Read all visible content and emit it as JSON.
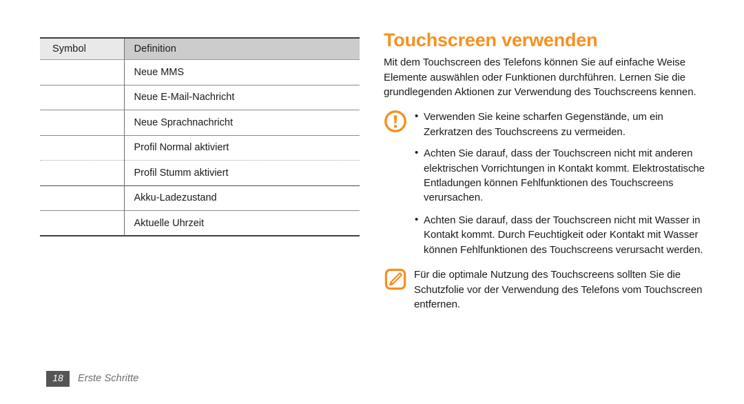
{
  "table": {
    "headers": [
      "Symbol",
      "Definition"
    ],
    "rows": [
      {
        "symbol_icon": "mms-message-icon",
        "definition": "Neue MMS"
      },
      {
        "symbol_icon": "email-message-icon",
        "definition": "Neue E-Mail-Nachricht"
      },
      {
        "symbol_icon": "voice-message-icon",
        "definition": "Neue Sprachnachricht"
      },
      {
        "symbol_icon": "profile-normal-icon",
        "definition": "Profil Normal aktiviert"
      },
      {
        "symbol_icon": "profile-silent-icon",
        "definition": "Profil Stumm aktiviert"
      },
      {
        "symbol_icon": "battery-level-icon",
        "definition": "Akku-Ladezustand"
      },
      {
        "symbol_icon": "clock-icon",
        "definition": "Aktuelle Uhrzeit"
      }
    ]
  },
  "article": {
    "title": "Touchscreen verwenden",
    "intro": "Mit dem Touchscreen des Telefons können Sie auf einfache Weise Elemente auswählen oder Funktionen durchführen. Lernen Sie die grundlegenden Aktionen zur Verwendung des Touchscreens kennen.",
    "warning": {
      "icon": "warning-exclamation-icon",
      "bullets": [
        "Verwenden Sie keine scharfen Gegenstände, um ein Zerkratzen des Touchscreens zu vermeiden.",
        "Achten Sie darauf, dass der Touchscreen nicht mit anderen elektrischen Vorrichtungen in Kontakt kommt. Elektrostatische Entladungen können Fehlfunktionen des Touchscreens verursachen."
      ],
      "bullets_continued": [
        "Achten Sie darauf, dass der Touchscreen nicht mit Wasser in Kontakt kommt. Durch Feuchtigkeit oder Kontakt mit Wasser können Fehlfunktionen des Touchscreens verursacht werden."
      ]
    },
    "note": {
      "icon": "note-pencil-icon",
      "text": "Für die optimale Nutzung des Touchscreens sollten Sie die Schutzfolie vor der Verwendung des Telefons vom Touchscreen entfernen."
    }
  },
  "footer": {
    "page_number": "18",
    "section_label": "Erste Schritte"
  },
  "colors": {
    "accent_orange": "#F7901E",
    "header_symbol_bg": "#E9E9E9",
    "header_definition_bg": "#CCCCCC",
    "footer_badge_bg": "#555555",
    "footer_label": "#6B6B6B",
    "text": "#1A1A1A"
  }
}
